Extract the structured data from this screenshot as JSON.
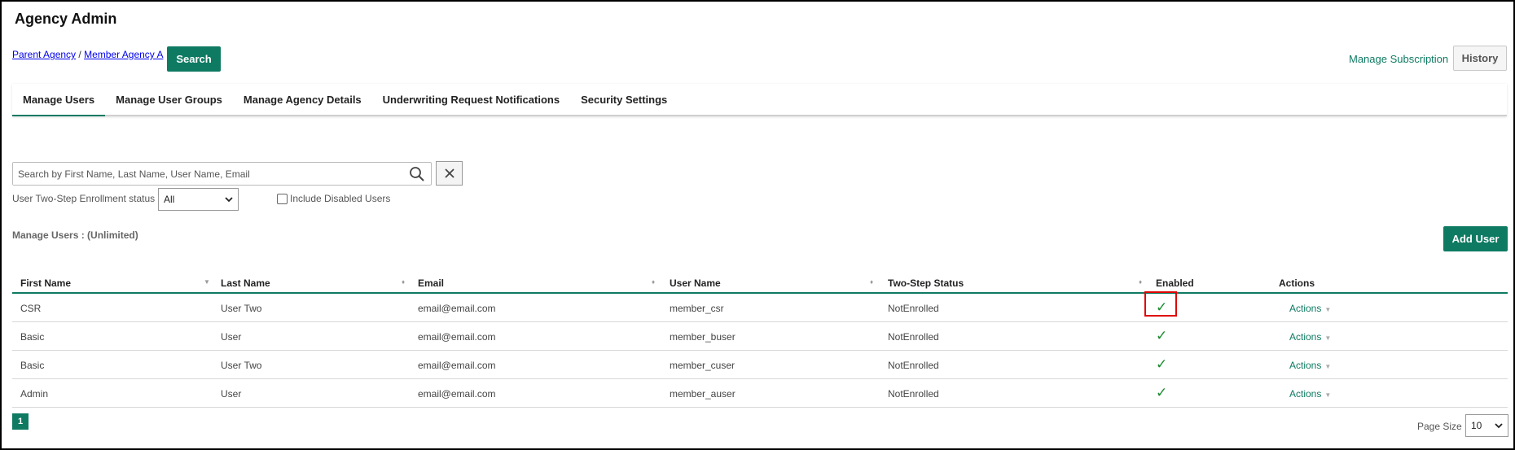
{
  "page": {
    "title": "Agency Admin"
  },
  "breadcrumb": {
    "parent": "Parent Agency",
    "separator": " / ",
    "member": "Member Agency A"
  },
  "toolbar": {
    "search_label": "Search",
    "manage_subscription": "Manage Subscription",
    "history_label": "History"
  },
  "tabs": [
    {
      "label": "Manage Users",
      "active": true
    },
    {
      "label": "Manage User Groups",
      "active": false
    },
    {
      "label": "Manage Agency Details",
      "active": false
    },
    {
      "label": "Underwriting Request Notifications",
      "active": false
    },
    {
      "label": "Security Settings",
      "active": false
    }
  ],
  "filters": {
    "search_placeholder": "Search by First Name, Last Name, User Name, Email",
    "search_icon": "search-icon",
    "clear_icon": "close-icon",
    "enrollment_label": "User Two-Step Enrollment status",
    "enrollment_value": "All",
    "include_disabled_label": "Include Disabled Users",
    "include_disabled_checked": false
  },
  "users_section": {
    "count_label": "Manage Users : (Unlimited)",
    "add_user_label": "Add User"
  },
  "table": {
    "columns": [
      "First Name",
      "Last Name",
      "Email",
      "User Name",
      "Two-Step Status",
      "Enabled",
      "Actions"
    ],
    "rows": [
      {
        "first": "CSR",
        "last": "User Two",
        "email": "email@email.com",
        "username": "member_csr",
        "status": "NotEnrolled",
        "enabled": "✓",
        "actions": "Actions"
      },
      {
        "first": "Basic",
        "last": "User",
        "email": "email@email.com",
        "username": "member_buser",
        "status": "NotEnrolled",
        "enabled": "✓",
        "actions": "Actions"
      },
      {
        "first": "Basic",
        "last": "User Two",
        "email": "email@email.com",
        "username": "member_cuser",
        "status": "NotEnrolled",
        "enabled": "✓",
        "actions": "Actions"
      },
      {
        "first": "Admin",
        "last": "User",
        "email": "email@email.com",
        "username": "member_auser",
        "status": "NotEnrolled",
        "enabled": "✓",
        "actions": "Actions"
      }
    ]
  },
  "pagination": {
    "current_page": "1",
    "page_size_label": "Page Size",
    "page_size_value": "10"
  },
  "colors": {
    "accent": "#0e7a62",
    "check": "#1a8a2e",
    "highlight": "#e00000",
    "link": "#0000ee"
  }
}
